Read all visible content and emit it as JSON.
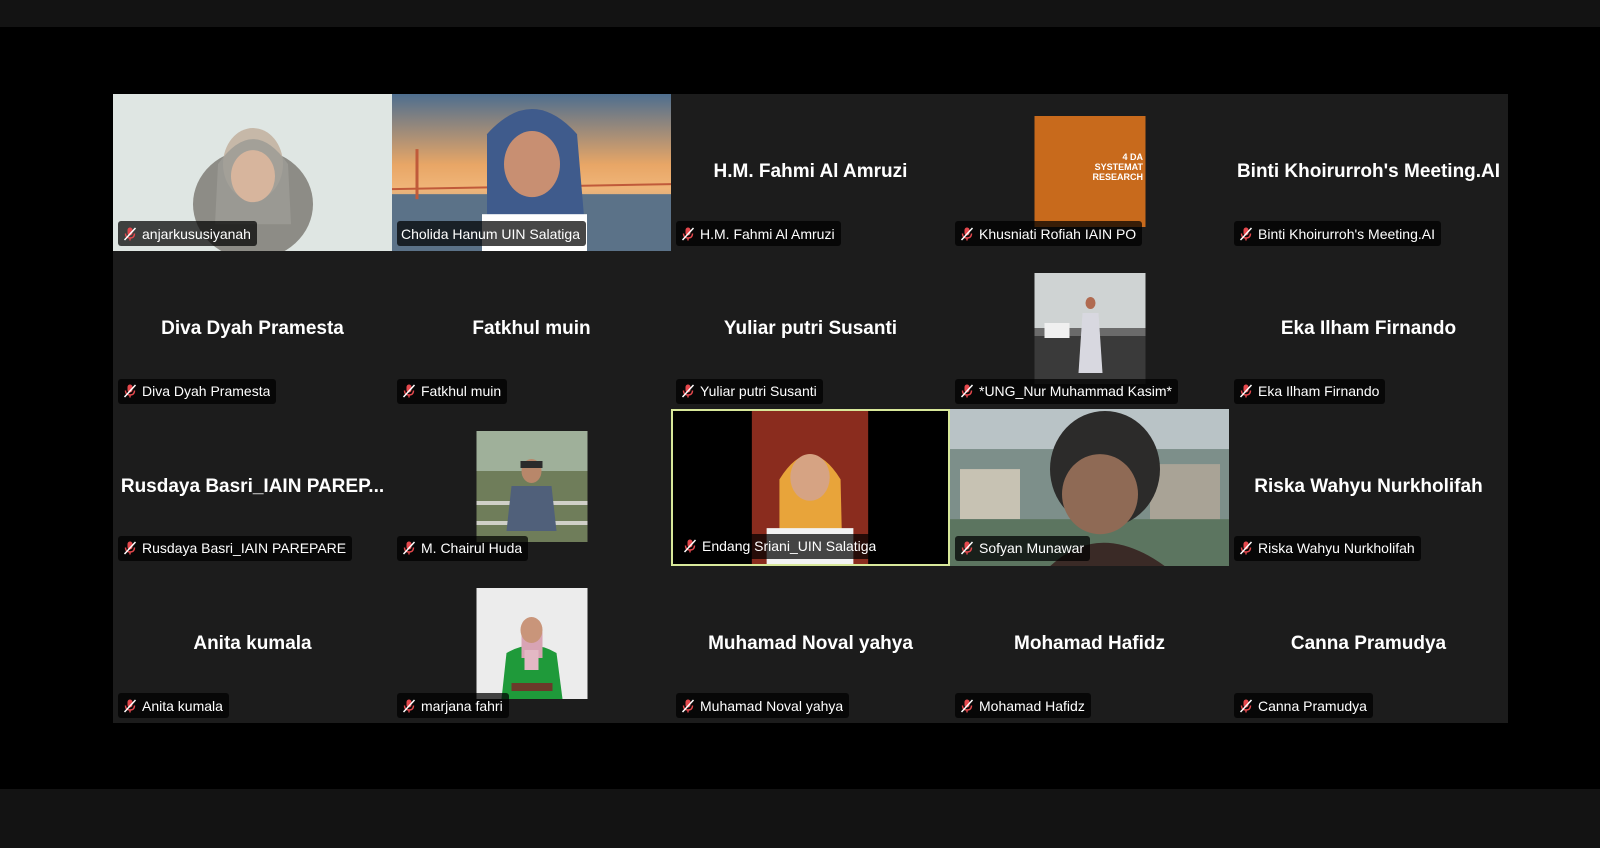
{
  "meeting": {
    "participants": [
      {
        "display_name": "",
        "label": "anjarkususiyanah"
      },
      {
        "display_name": "",
        "label": "Cholida Hanum UIN Salatiga"
      },
      {
        "display_name": "H.M. Fahmi Al Amruzi",
        "label": "H.M. Fahmi Al Amruzi"
      },
      {
        "display_name": "",
        "label": "Khusniati Rofiah IAIN PO",
        "shared_text": [
          "4 DA",
          "SYSTEMAT",
          "RESEARCH"
        ]
      },
      {
        "display_name": "Binti Khoirurroh's Meeting.AI",
        "label": "Binti Khoirurroh's Meeting.AI"
      },
      {
        "display_name": "Diva Dyah Pramesta",
        "label": "Diva Dyah Pramesta"
      },
      {
        "display_name": "Fatkhul muin",
        "label": "Fatkhul muin"
      },
      {
        "display_name": "Yuliar putri Susanti",
        "label": "Yuliar putri Susanti"
      },
      {
        "display_name": "",
        "label": "*UNG_Nur Muhammad Kasim*"
      },
      {
        "display_name": "Eka Ilham Firnando",
        "label": "Eka Ilham Firnando"
      },
      {
        "display_name": "Rusdaya Basri_IAIN PAREP...",
        "label": "Rusdaya Basri_IAIN PAREPARE"
      },
      {
        "display_name": "",
        "label": "M. Chairul Huda"
      },
      {
        "display_name": "",
        "label": "Endang Sriani_UIN Salatiga"
      },
      {
        "display_name": "",
        "label": "Sofyan Munawar"
      },
      {
        "display_name": "Riska Wahyu Nurkholifah",
        "label": "Riska Wahyu Nurkholifah"
      },
      {
        "display_name": "Anita kumala",
        "label": "Anita kumala"
      },
      {
        "display_name": "",
        "label": "marjana fahri"
      },
      {
        "display_name": "Muhamad Noval yahya",
        "label": "Muhamad Noval yahya"
      },
      {
        "display_name": "Mohamad Hafidz",
        "label": "Mohamad Hafidz"
      },
      {
        "display_name": "Canna Pramudya",
        "label": "Canna Pramudya"
      }
    ]
  },
  "colors": {
    "background": "#000000",
    "bars": "#131313",
    "tile": "#1c1c1c",
    "active_speaker_border": "#d8e89a",
    "muted_icon": "#e5484d"
  },
  "icons": {
    "muted": "microphone-muted-icon"
  }
}
